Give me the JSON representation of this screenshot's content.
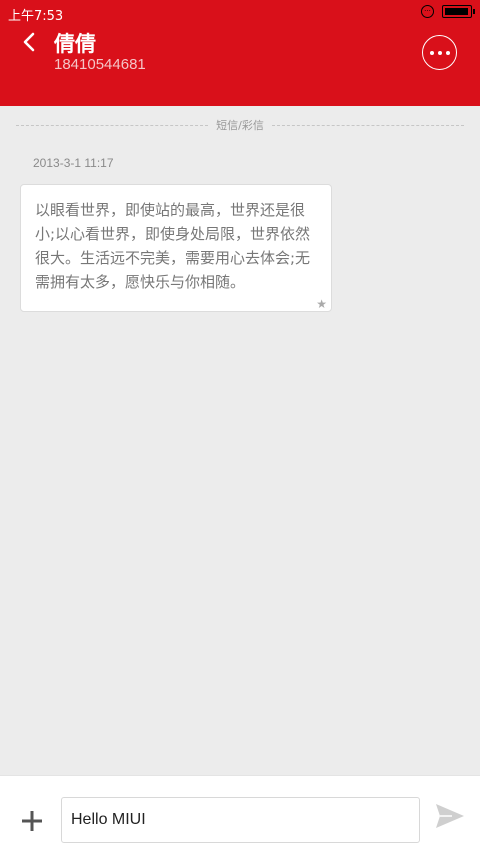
{
  "status_bar": {
    "time": "上午7:53",
    "battery_level": 0.95
  },
  "header": {
    "title": "倩倩",
    "phone": "18410544681"
  },
  "thread": {
    "divider_label": "短信/彩信",
    "messages": [
      {
        "timestamp": "2013-3-1 11:17",
        "text": "以眼看世界，即使站的最高，世界还是很小;以心看世界，即使身处局限，世界依然很大。生活远不完美，需要用心去体会;无需拥有太多，愿快乐与你相随。",
        "starred": true
      }
    ]
  },
  "composer": {
    "value": "Hello MIUI"
  },
  "colors": {
    "header": "#d9101a",
    "background": "#ececec"
  },
  "icons": {
    "back": "chevron-left-icon",
    "more": "more-dots-icon",
    "add": "plus-icon",
    "send": "send-icon",
    "star": "star-icon"
  }
}
